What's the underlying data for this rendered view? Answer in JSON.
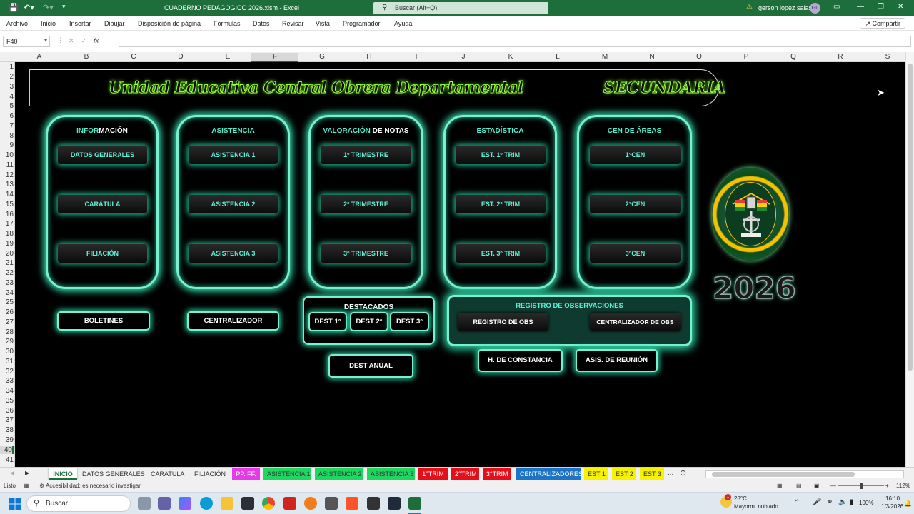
{
  "window": {
    "title": "CUADERNO PEDAGOGICO 2026.xlsm  -  Excel",
    "search_placeholder": "Buscar (Alt+Q)",
    "user": "gerson lopez salas",
    "user_initials": "GL"
  },
  "menu": [
    "Archivo",
    "Inicio",
    "Insertar",
    "Dibujar",
    "Disposición de página",
    "Fórmulas",
    "Datos",
    "Revisar",
    "Vista",
    "Programador",
    "Ayuda"
  ],
  "share_label": "Compartir",
  "namebox": "F40",
  "fx": "fx",
  "columns": [
    "A",
    "B",
    "C",
    "D",
    "E",
    "F",
    "G",
    "H",
    "I",
    "J",
    "K",
    "L",
    "M",
    "N",
    "O",
    "P",
    "Q",
    "R",
    "S"
  ],
  "rows": [
    "1",
    "2",
    "3",
    "4",
    "5",
    "6",
    "7",
    "8",
    "9",
    "10",
    "11",
    "12",
    "13",
    "14",
    "15",
    "16",
    "17",
    "18",
    "19",
    "20",
    "21",
    "22",
    "23",
    "24",
    "25",
    "26",
    "27",
    "28",
    "29",
    "30",
    "31",
    "32",
    "33",
    "34",
    "35",
    "36",
    "37",
    "38",
    "39",
    "40",
    "41"
  ],
  "banner": {
    "school": "Unidad Educativa Central Obrera Departamental",
    "level": "SECUNDARIA"
  },
  "panels": [
    {
      "title_hl": "INFOR",
      "title_rest": "MACIÓN",
      "buttons": [
        "DATOS GENERALES",
        "CARÁTULA",
        "FILIACIÓN"
      ]
    },
    {
      "title_hl": "",
      "title_rest": "ASISTENCIA",
      "buttons": [
        "ASISTENCIA 1",
        "ASISTENCIA 2",
        "ASISTENCIA 3"
      ]
    },
    {
      "title_hl": "VALORACIÓN",
      "title_rest": " DE NOTAS",
      "buttons": [
        "1º TRIMESTRE",
        "2º TRIMESTRE",
        "3º TRIMESTRE"
      ]
    },
    {
      "title_hl": "",
      "title_rest": "ESTADÍSTICA",
      "buttons": [
        "EST. 1º TRIM",
        "EST. 2º TRIM",
        "EST. 3º TRIM"
      ]
    },
    {
      "title_hl": "CEN DE",
      "title_rest": " ÁREAS",
      "buttons": [
        "1°CEN",
        "2°CEN",
        "3°CEN"
      ]
    }
  ],
  "bottom": {
    "boletines": "BOLETINES",
    "centralizador": "CENTRALIZADOR",
    "destacados": "DESTACADOS",
    "dest": [
      "DEST 1°",
      "DEST 2°",
      "DEST 3°"
    ],
    "dest_anual": "DEST ANUAL",
    "registro_title": "REGISTRO DE OBSERVACIONES",
    "registro_obs": "REGISTRO DE OBS",
    "centralizador_obs": "CENTRALIZADOR DE OBS",
    "constancia": "H. DE CONSTANCIA",
    "reunion": "ASIS. DE REUNIÓN"
  },
  "year": "2026",
  "logo_text": "U.E. CENTRAL OBRERA DEPARTAMENTAL · S.SECUNDARIA",
  "sheet_tabs": [
    {
      "label": "INICIO",
      "bg": "#ffffff",
      "fg": "#1e6e3b"
    },
    {
      "label": "DATOS GENERALES",
      "bg": "#f0f0f0",
      "fg": "#333"
    },
    {
      "label": "CARATULA",
      "bg": "#f0f0f0",
      "fg": "#333"
    },
    {
      "label": "FILIACIÓN",
      "bg": "#f0f0f0",
      "fg": "#333"
    },
    {
      "label": "PP. FF.",
      "bg": "#e53be6",
      "fg": "#ffffff"
    },
    {
      "label": "ASISTENCIA 1",
      "bg": "#1ed760",
      "fg": "#333"
    },
    {
      "label": "ASISTENCIA 2",
      "bg": "#1ed760",
      "fg": "#333"
    },
    {
      "label": "ASISTENCIA 3",
      "bg": "#1ed760",
      "fg": "#333"
    },
    {
      "label": "1°TRIM",
      "bg": "#e3101b",
      "fg": "#ffffff"
    },
    {
      "label": "2°TRIM",
      "bg": "#e3101b",
      "fg": "#ffffff"
    },
    {
      "label": "3°TRIM",
      "bg": "#e3101b",
      "fg": "#ffffff"
    },
    {
      "label": "CENTRALIZADORES",
      "bg": "#1b74c6",
      "fg": "#ffffff"
    },
    {
      "label": "EST 1",
      "bg": "#f6f200",
      "fg": "#333"
    },
    {
      "label": "EST 2",
      "bg": "#f6f200",
      "fg": "#333"
    },
    {
      "label": "EST 3",
      "bg": "#f6f200",
      "fg": "#333"
    }
  ],
  "tabs_more": "...",
  "status": {
    "ready": "Listo",
    "accessibility": "Accesibilidad: es necesario investigar",
    "zoom": "112%"
  },
  "taskbar": {
    "search": "Buscar",
    "weather_temp": "28°C",
    "weather_desc": "Mayorm. nublado",
    "battery": "100%",
    "time": "16:10",
    "date": "1/3/2026",
    "weather_badge": "1"
  }
}
